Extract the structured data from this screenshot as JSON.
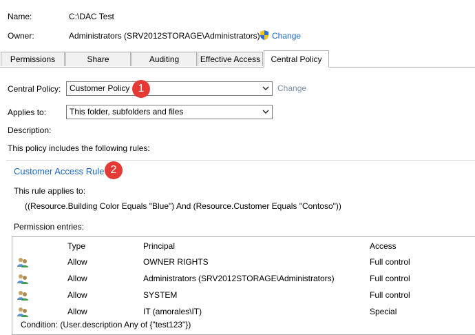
{
  "header": {
    "name_label": "Name:",
    "name_value": "C:\\DAC Test",
    "owner_label": "Owner:",
    "owner_value": "Administrators (SRV2012STORAGE\\Administrators)",
    "owner_change": "Change"
  },
  "tabs": [
    {
      "label": "Permissions"
    },
    {
      "label": "Share"
    },
    {
      "label": "Auditing"
    },
    {
      "label": "Effective Access"
    },
    {
      "label": "Central Policy"
    }
  ],
  "central_policy": {
    "label": "Central Policy:",
    "value": "Customer Policy",
    "change": "Change",
    "badge": "1"
  },
  "applies_to": {
    "label": "Applies to:",
    "value": "This folder, subfolders and files"
  },
  "description_label": "Description:",
  "rules_intro": "This policy includes the following rules:",
  "rule": {
    "name": "Customer Access Rule",
    "badge": "2",
    "applies_label": "This rule applies to:",
    "expression": "((Resource.Building Color Equals \"Blue\") And (Resource.Customer Equals \"Contoso\"))",
    "permission_entries_label": "Permission entries:"
  },
  "table": {
    "headers": {
      "type": "Type",
      "principal": "Principal",
      "access": "Access"
    },
    "rows": [
      {
        "type": "Allow",
        "principal": "OWNER RIGHTS",
        "access": "Full control"
      },
      {
        "type": "Allow",
        "principal": "Administrators (SRV2012STORAGE\\Administrators)",
        "access": "Full control"
      },
      {
        "type": "Allow",
        "principal": "SYSTEM",
        "access": "Full control"
      },
      {
        "type": "Allow",
        "principal": "IT (amorales\\IT)",
        "access": "Special"
      }
    ],
    "condition": "Condition: (User.description Any of {\"test123\"})"
  },
  "colors": {
    "link": "#1a66c2",
    "badge": "#e53935",
    "border": "#adadad"
  },
  "icons": [
    "shield-icon",
    "dropdown-arrow-icon",
    "users-icon"
  ]
}
